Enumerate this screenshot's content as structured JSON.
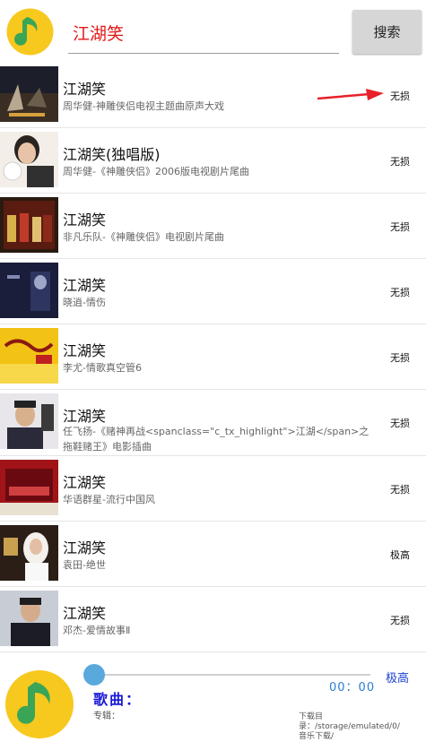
{
  "search": {
    "query": "江湖笑",
    "button_label": "搜索"
  },
  "songs": [
    {
      "title": "江湖笑",
      "subtitle": "周华健-神雕侠侣电视主题曲原声大戏",
      "quality": "无损"
    },
    {
      "title": "江湖笑(独唱版)",
      "subtitle": "周华健-《神雕侠侣》2006版电视剧片尾曲",
      "quality": "无损"
    },
    {
      "title": "江湖笑",
      "subtitle": "非凡乐队-《神雕侠侣》电视剧片尾曲",
      "quality": "无损"
    },
    {
      "title": "江湖笑",
      "subtitle": "晓逍-情伤",
      "quality": "无损"
    },
    {
      "title": "江湖笑",
      "subtitle": "李尤-情歌真空管6",
      "quality": "无损"
    },
    {
      "title": "江湖笑",
      "subtitle": "任飞扬-《赌神再战<spanclass=\"c_tx_highlight\">江湖</span>之拖鞋赌王》电影插曲",
      "quality": "无损"
    },
    {
      "title": "江湖笑",
      "subtitle": "华语群星-流行中国风",
      "quality": "无损"
    },
    {
      "title": "江湖笑",
      "subtitle": "袁田-绝世",
      "quality": "极高"
    },
    {
      "title": "江湖笑",
      "subtitle": "邓杰-爱情故事Ⅱ",
      "quality": "无损"
    }
  ],
  "player": {
    "time": "00：00",
    "quality_link": "极高",
    "song_label": "歌曲：",
    "album_label": "专辑：",
    "download_path": "下载目录：/storage/emulated/0/音乐下载/",
    "progress": 0
  },
  "colors": {
    "logo_yellow": "#f7c81e",
    "logo_green": "#3aa556",
    "query_red": "#e01818",
    "arrow_red": "#e8202a",
    "accent_blue": "#1a3fd6"
  },
  "icons": {
    "logo": "qq-music-note-icon",
    "annotation": "red-arrow-icon"
  }
}
